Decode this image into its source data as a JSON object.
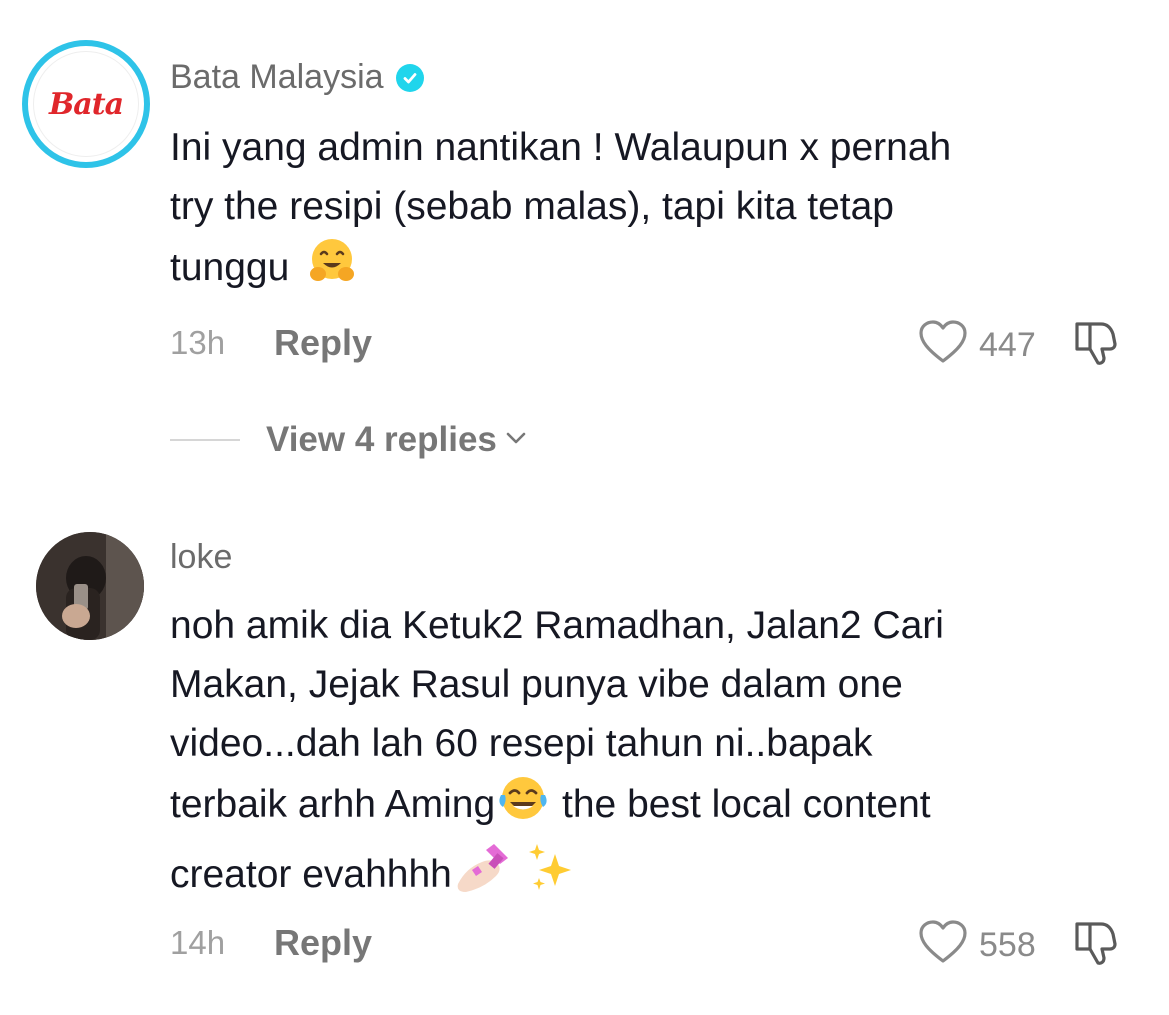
{
  "comments": [
    {
      "username": "Bata Malaysia",
      "verified": true,
      "avatar_text": "Bata",
      "text_lines": [
        "Ini yang admin nantikan ! Walaupun x pernah",
        "try the resipi (sebab malas), tapi kita tetap",
        "tunggu"
      ],
      "emoji_after_text": [
        "hugging-face"
      ],
      "time": "13h",
      "reply_label": "Reply",
      "likes": "447",
      "view_replies": "View 4 replies"
    },
    {
      "username": "loke",
      "verified": false,
      "text_lines": [
        "noh amik dia Ketuk2 Ramadhan, Jalan2 Cari",
        "Makan, Jejak Rasul punya vibe dalam one",
        "video...dah lah 60 resepi tahun ni..bapak",
        "terbaik arhh Aming",
        " the best local content",
        "creator evahhhh"
      ],
      "emoji_inline": [
        "tears-of-joy",
        "nail-polish",
        "sparkles"
      ],
      "time": "14h",
      "reply_label": "Reply",
      "likes": "558"
    }
  ],
  "colors": {
    "verified_badge": "#20d5ec",
    "avatar_ring": "#2ec3e8",
    "bata_red": "#e0262b"
  }
}
